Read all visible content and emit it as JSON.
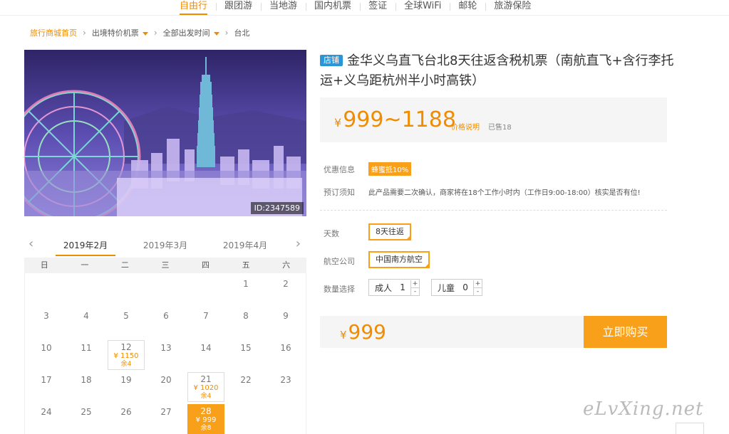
{
  "nav": [
    "自由行",
    "跟团游",
    "当地游",
    "国内机票",
    "签证",
    "全球WiFi",
    "邮轮",
    "旅游保险"
  ],
  "breadcrumb": {
    "home": "旅行商城首页",
    "level2": "出境特价机票",
    "level3": "全部出发时间",
    "level4": "台北"
  },
  "photo": {
    "id_label": "ID:2347589"
  },
  "calendar": {
    "months": [
      "2019年2月",
      "2019年3月",
      "2019年4月"
    ],
    "weekdays": [
      "日",
      "一",
      "二",
      "三",
      "四",
      "五",
      "六"
    ],
    "days": {
      "d1": "1",
      "d2": "2",
      "d3": "3",
      "d4": "4",
      "d5": "5",
      "d6": "6",
      "d7": "7",
      "d8": "8",
      "d9": "9",
      "d10": "10",
      "d11": "11",
      "d12": "12",
      "d13": "13",
      "d14": "14",
      "d15": "15",
      "d16": "16",
      "d17": "17",
      "d18": "18",
      "d19": "19",
      "d20": "20",
      "d21": "21",
      "d22": "22",
      "d23": "23",
      "d24": "24",
      "d25": "25",
      "d26": "26",
      "d27": "27",
      "d28": "28"
    },
    "priced": {
      "d12": {
        "price": "¥ 1150",
        "remain": "余4"
      },
      "d21": {
        "price": "¥ 1020",
        "remain": "余4"
      },
      "d28": {
        "price": "¥ 999",
        "remain": "余8"
      }
    }
  },
  "product": {
    "badge": "店铺",
    "title": "金华义乌直飞台北8天往返含税机票（南航直飞+含行李托运+义乌距杭州半小时高铁）",
    "currency": "¥",
    "price_range": "999~1188",
    "price_note": "价格说明",
    "sold": "已售18"
  },
  "info": {
    "promo_label": "优惠信息",
    "promo_tag": "蜂蜜抵10%",
    "notice_label": "预订须知",
    "notice_text": "此产品需要二次确认，商家将在18个工作小时内（工作日9:00-18:00）核实是否有位!"
  },
  "options": {
    "days_label": "天数",
    "days_value": "8天往返",
    "airline_label": "航空公司",
    "airline_value": "中国南方航空",
    "qty_label": "数量选择",
    "adult_label": "成人",
    "adult_count": "1",
    "child_label": "儿童",
    "child_count": "0",
    "plus": "+",
    "minus": "-"
  },
  "buy": {
    "currency": "¥",
    "price": "999",
    "button": "立即购买"
  },
  "watermark": "eLvXing.net"
}
